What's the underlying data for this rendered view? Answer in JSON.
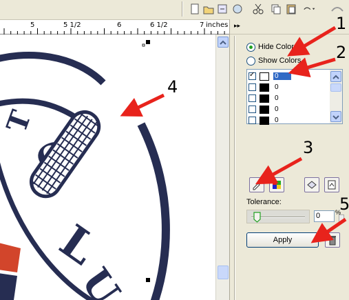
{
  "ruler": {
    "ticks": [
      "5",
      "5 1/2",
      "6",
      "6 1/2",
      "7"
    ],
    "unit": "inches"
  },
  "docker": {
    "expand_glyph": "▸▸",
    "hide_colors_label": "Hide Colors",
    "show_colors_label": "Show Colors",
    "selected_mode": "hide",
    "colors": [
      {
        "checked": true,
        "swatch": "#ffffff",
        "value": "0",
        "selected": true
      },
      {
        "checked": false,
        "swatch": "#000000",
        "value": "0",
        "selected": false
      },
      {
        "checked": false,
        "swatch": "#000000",
        "value": "0",
        "selected": false
      },
      {
        "checked": false,
        "swatch": "#000000",
        "value": "0",
        "selected": false
      },
      {
        "checked": false,
        "swatch": "#000000",
        "value": "0",
        "selected": false
      }
    ],
    "tolerance_label": "Tolerance:",
    "tolerance_value": "0",
    "tolerance_unit": "%",
    "apply_label": "Apply"
  },
  "artwork": {
    "letters": [
      "T",
      "C",
      "L",
      "U"
    ],
    "ink_color": "#262d52",
    "accent_color": "#d2452b"
  },
  "callouts": [
    "1",
    "2",
    "3",
    "4",
    "5"
  ],
  "colors": {
    "arrow": "#e8231c",
    "panel_bg": "#ece9d8",
    "selection": "#316ac5"
  }
}
